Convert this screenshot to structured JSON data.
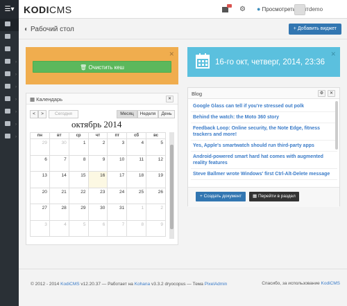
{
  "brand": {
    "prefix": "KODI",
    "suffix": "CMS"
  },
  "topbar": {
    "view_site": "Просмотреть сайт",
    "user_name": "demo"
  },
  "sidebar": {
    "items": [
      {
        "icon": "dashboard-icon",
        "active": true
      },
      {
        "icon": "pages-icon"
      },
      {
        "icon": "calendar-icon"
      },
      {
        "icon": "folder-icon"
      },
      {
        "icon": "layout-icon"
      },
      {
        "icon": "list-icon"
      },
      {
        "icon": "users-icon"
      },
      {
        "icon": "monitor-icon"
      },
      {
        "icon": "settings-icon"
      },
      {
        "icon": "sitemap-icon"
      }
    ]
  },
  "header": {
    "title": "Рабочий стол",
    "add_widget": "Добавить виджет"
  },
  "cache_widget": {
    "button": "Очистить кеш"
  },
  "date_widget": {
    "text": "16-го окт, четверг, 2014, 23:36"
  },
  "calendar": {
    "title": "Календарь",
    "nav": {
      "prev": "<",
      "next": ">",
      "today": "Сегодня",
      "month": "Месяц",
      "week": "Неделя",
      "day": "День"
    },
    "month_title": "октябрь 2014",
    "weekdays": [
      "пн",
      "вт",
      "ср",
      "чт",
      "пт",
      "сб",
      "вс"
    ],
    "weeks": [
      [
        "29",
        "30",
        "1",
        "2",
        "3",
        "4",
        "5"
      ],
      [
        "6",
        "7",
        "8",
        "9",
        "10",
        "11",
        "12"
      ],
      [
        "13",
        "14",
        "15",
        "16",
        "17",
        "18",
        "19"
      ],
      [
        "20",
        "21",
        "22",
        "23",
        "24",
        "25",
        "26"
      ],
      [
        "27",
        "28",
        "29",
        "30",
        "31",
        "1",
        "2"
      ],
      [
        "3",
        "4",
        "5",
        "6",
        "7",
        "8",
        "9"
      ]
    ]
  },
  "blog": {
    "title": "Blog",
    "items": [
      "Google Glass can tell if you're stressed out polk",
      "Behind the watch: the Moto 360 story",
      "Feedback Loop: Online security, the Note Edge, fitness trackers and more!",
      "Yes, Apple's smartwatch should run third-party apps",
      "Android-powered smart hard hat comes with augmented reality features",
      "Steve Ballmer wrote Windows' first Ctrl-Alt-Delete message"
    ],
    "create_button": "Создать документ",
    "goto_button": "Перейти в раздел"
  },
  "footer": {
    "copyright": "© 2012 - 2014",
    "app_link": "KodiCMS",
    "version": "v12.20.37",
    "powered": "— Работает на",
    "kohana_link": "Kohana",
    "kohana_version": "v3.3.2 dryocopus",
    "theme": "— Тема",
    "theme_link": "PixelAdmin",
    "thanks": "Спасибо, за использование",
    "thanks_link": "KodiCMS"
  }
}
